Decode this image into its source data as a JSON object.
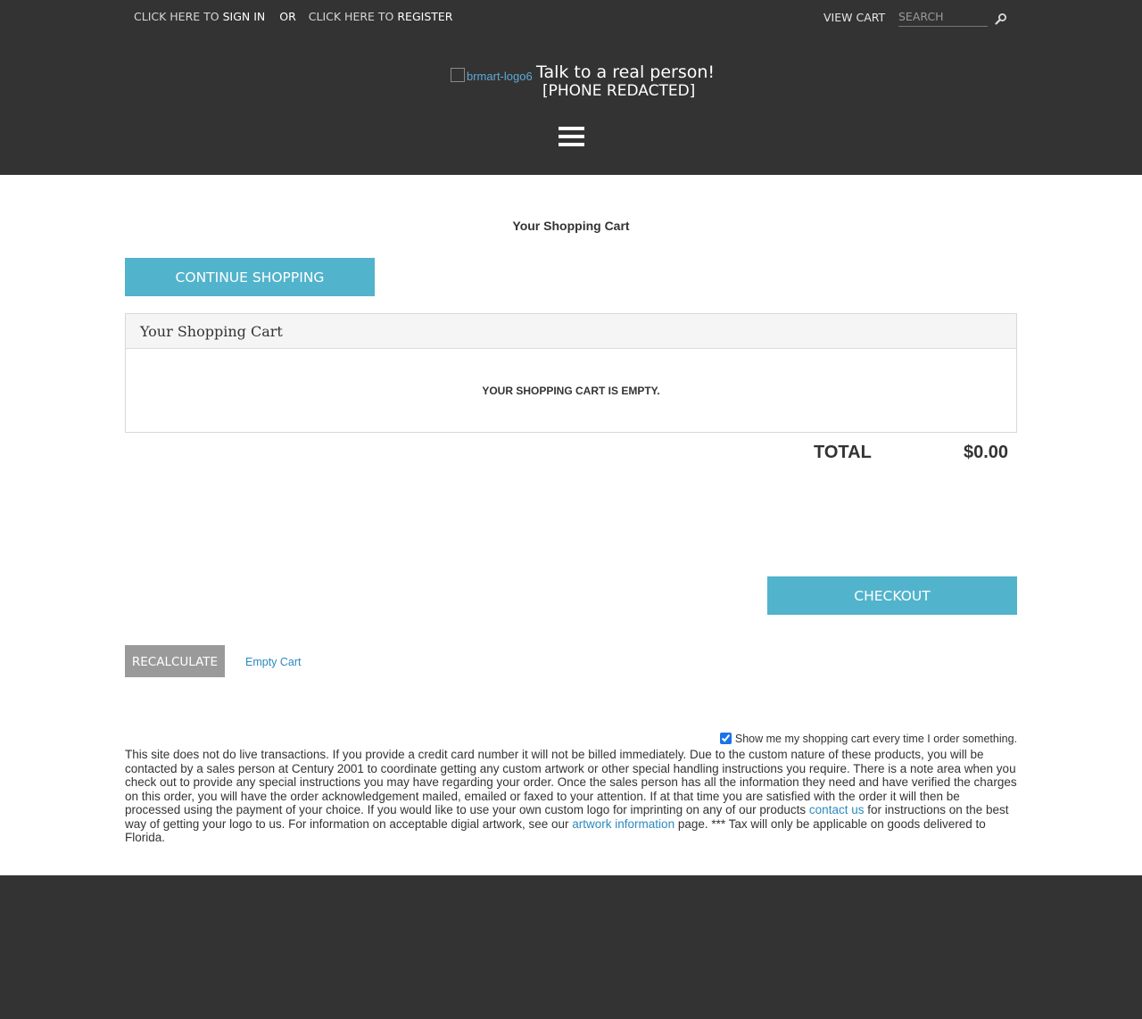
{
  "header": {
    "top_links": {
      "sign_in_prefix": "CLICK HERE TO ",
      "sign_in": "SIGN IN",
      "or": "OR",
      "register_prefix": "CLICK HERE TO ",
      "register": "REGISTER"
    },
    "view_cart": "VIEW CART",
    "search_placeholder": "SEARCH",
    "logo_alt": "brmart-logo6",
    "tagline": "Talk to a real person!",
    "phone": "[PHONE REDACTED]"
  },
  "main": {
    "page_title": "Your Shopping Cart",
    "continue_shopping": "CONTINUE SHOPPING",
    "panel_title": "Your Shopping Cart",
    "empty_message": "YOUR SHOPPING CART IS EMPTY.",
    "total_label": "TOTAL",
    "total_value": "$0.00",
    "checkout": "CHECKOUT",
    "recalculate": "RECALCULATE",
    "empty_cart_link": "Empty Cart",
    "show_cart_label": "Show me my shopping cart every time I order something.",
    "show_cart_checked": true,
    "disclaimer": {
      "part1": "This site does not do live transactions. If you provide a credit card number it will not be billed immediately. Due to the custom nature of these products, you will be contacted by a sales person at Century 2001 to coordinate getting any custom artwork or other special handling instructions you require. There is a note area when you check out to provide any special instructions you may have regarding your order. Once the sales person has all the information they need and have verified the charges on this order, you will have the order acknowledgement mailed, emailed or faxed to your attention. If at that time you are satisfied with the order it will then be processed using the payment of your choice. If you would like to use your own custom logo for imprinting on any of our products ",
      "contact_link": "contact us",
      "part2": " for instructions on the best way of getting your logo to us. For information on acceptable digial artwork, see our ",
      "artwork_link": "artwork information",
      "part3": " page. *** Tax will only be applicable on goods delivered to Florida."
    }
  },
  "colors": {
    "header_bg": "#333333",
    "button_teal": "#52b3cc",
    "button_gray": "#9a9a9a",
    "link_blue": "#2b8ac0"
  }
}
